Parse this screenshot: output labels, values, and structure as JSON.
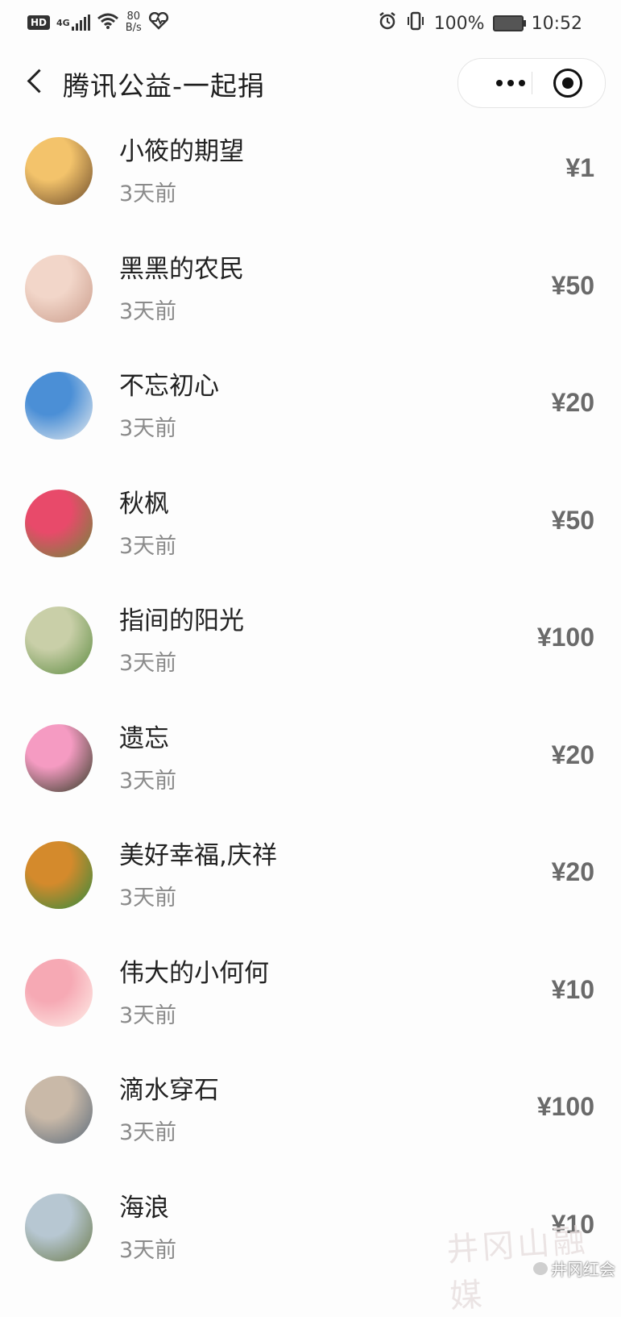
{
  "status_bar": {
    "hd": "HD",
    "network": "4G",
    "speed_value": "80",
    "speed_unit": "B/s",
    "battery": "100%",
    "time": "10:52"
  },
  "nav": {
    "title": "腾讯公益-一起捐"
  },
  "donations": [
    {
      "name": "小筱的期望",
      "time": "3天前",
      "amount": "¥1",
      "avatar_colors": [
        "#f3c36b",
        "#6b4a2a"
      ]
    },
    {
      "name": "黑黑的农民",
      "time": "3天前",
      "amount": "¥50",
      "avatar_colors": [
        "#f2d6c9",
        "#c99b8a"
      ]
    },
    {
      "name": "不忘初心",
      "time": "3天前",
      "amount": "¥20",
      "avatar_colors": [
        "#4b8fd6",
        "#e8ecef"
      ]
    },
    {
      "name": "秋枫",
      "time": "3天前",
      "amount": "¥50",
      "avatar_colors": [
        "#e84a6a",
        "#6b8a3a"
      ]
    },
    {
      "name": "指间的阳光",
      "time": "3天前",
      "amount": "¥100",
      "avatar_colors": [
        "#c9cfa8",
        "#5b8a3f"
      ]
    },
    {
      "name": "遗忘",
      "time": "3天前",
      "amount": "¥20",
      "avatar_colors": [
        "#f59bc2",
        "#2e3a22"
      ]
    },
    {
      "name": "美好幸福,庆祥",
      "time": "3天前",
      "amount": "¥20",
      "avatar_colors": [
        "#d48a2c",
        "#2e8b3f"
      ]
    },
    {
      "name": "伟大的小何何",
      "time": "3天前",
      "amount": "¥10",
      "avatar_colors": [
        "#f6a9b4",
        "#fff1ea"
      ]
    },
    {
      "name": "滴水穿石",
      "time": "3天前",
      "amount": "¥100",
      "avatar_colors": [
        "#c9b9a8",
        "#5a6a7a"
      ]
    },
    {
      "name": "海浪",
      "time": "3天前",
      "amount": "¥10",
      "avatar_colors": [
        "#b7c7d2",
        "#6b7a4a"
      ]
    }
  ],
  "watermark": {
    "logo_text": "井冈山融媒",
    "account": "井冈红会"
  }
}
